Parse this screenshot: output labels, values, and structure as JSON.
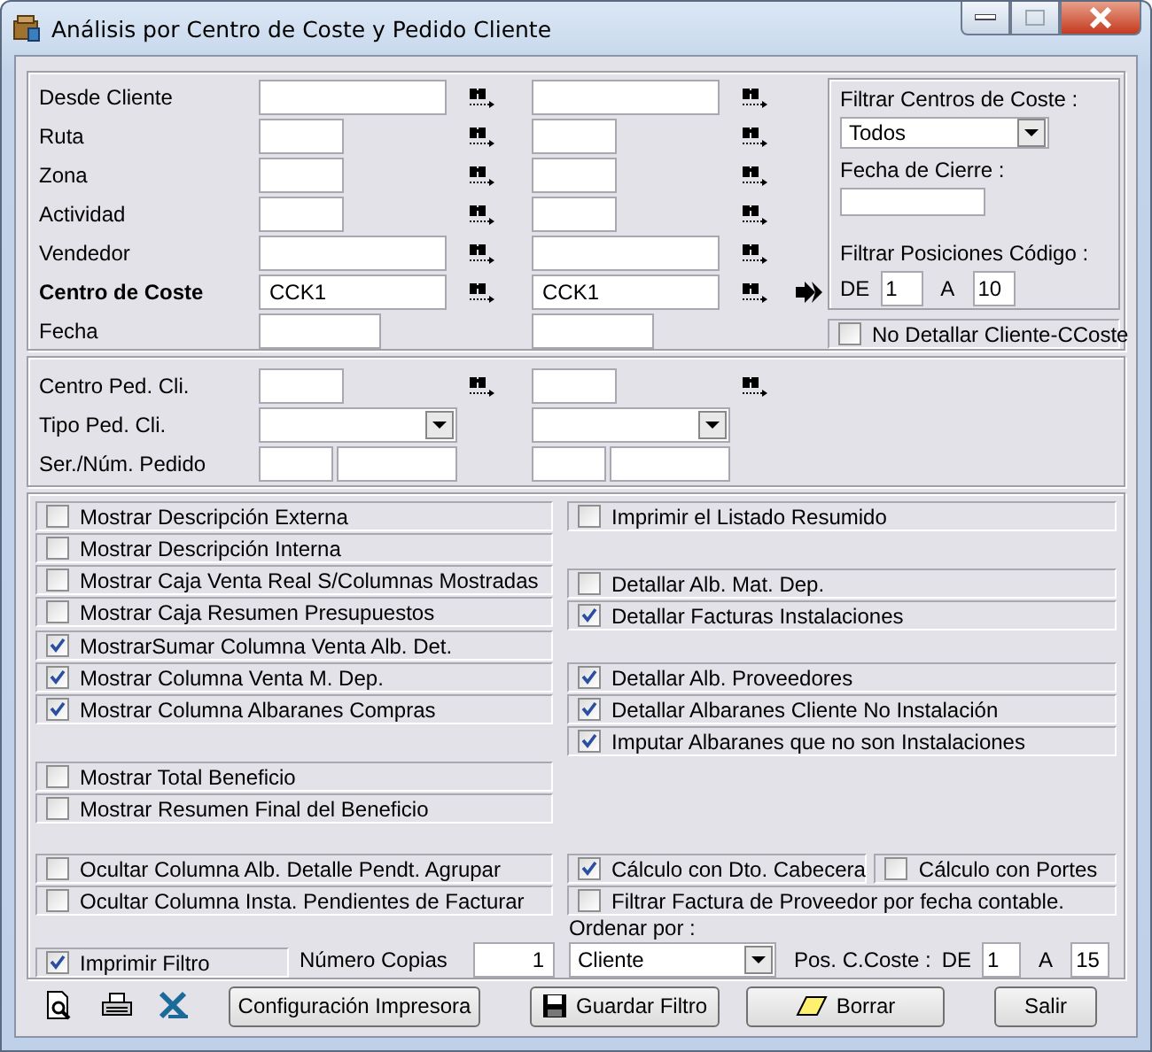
{
  "window": {
    "title": "Análisis por Centro de Coste y Pedido Cliente"
  },
  "filters": [
    {
      "label": "Desde Cliente",
      "kind": "wide",
      "bold": false,
      "search": true,
      "arrow": false
    },
    {
      "label": "Ruta",
      "kind": "short",
      "bold": false,
      "search": true,
      "arrow": false
    },
    {
      "label": "Zona",
      "kind": "short",
      "bold": false,
      "search": true,
      "arrow": false
    },
    {
      "label": "Actividad",
      "kind": "short",
      "bold": false,
      "search": true,
      "arrow": false
    },
    {
      "label": "Vendedor",
      "kind": "wide",
      "bold": false,
      "search": true,
      "arrow": false
    },
    {
      "label": "Centro de Coste",
      "kind": "wide",
      "bold": true,
      "search": true,
      "arrow": true,
      "from": "CCK1",
      "to": "CCK1"
    },
    {
      "label": "Fecha",
      "kind": "medium",
      "bold": false,
      "search": false,
      "arrow": false
    }
  ],
  "side": {
    "centros_label": "Filtrar Centros de Coste :",
    "centros_value": "Todos",
    "cierre_label": "Fecha de Cierre :",
    "pos_label": "Filtrar Posiciones Código :",
    "de_label": "DE",
    "from": "1",
    "a_label": "A",
    "to": "10",
    "no_detallar": {
      "label": "No Detallar Cliente-CCoste",
      "checked": false
    }
  },
  "pedido_filters": [
    {
      "label": "Centro Ped. Cli.",
      "kind": "short",
      "bold": false,
      "search": true,
      "arrow": false
    },
    {
      "label": "Tipo Ped. Cli.",
      "kind": "select",
      "bold": false,
      "search": false,
      "arrow": false
    },
    {
      "label": "Ser./Núm. Pedido",
      "kind": "pair",
      "bold": false,
      "search": false,
      "arrow": false
    }
  ],
  "left_groups": [
    {
      "rows": [
        [
          {
            "label": "Mostrar Descripción Externa",
            "checked": false
          }
        ],
        [
          {
            "label": "Mostrar Descripción Interna",
            "checked": false
          }
        ]
      ]
    },
    {
      "rows": [
        [
          {
            "label": "Mostrar Caja Venta Real S/Columnas Mostradas",
            "checked": false
          }
        ],
        [
          {
            "label": "Mostrar Caja Resumen Presupuestos",
            "checked": false
          }
        ]
      ]
    },
    {
      "rows": [
        [
          {
            "label": "MostrarSumar Columna Venta Alb. Det.",
            "checked": true
          }
        ],
        [
          {
            "label": "Mostrar Columna Venta M. Dep.",
            "checked": true
          }
        ],
        [
          {
            "label": "Mostrar Columna Albaranes Compras",
            "checked": true
          }
        ]
      ]
    },
    {
      "rows": [
        [
          {
            "label": "Mostrar Total Beneficio",
            "checked": false
          }
        ],
        [
          {
            "label": "Mostrar Resumen Final del Beneficio",
            "checked": false
          }
        ]
      ]
    }
  ],
  "right_groups": [
    {
      "rows": [
        [
          {
            "label": "Imprimir el Listado Resumido",
            "checked": false
          }
        ]
      ]
    },
    {
      "rows": [
        [
          {
            "label": "Detallar Alb. Mat. Dep.",
            "checked": false
          }
        ],
        [
          {
            "label": "Detallar Facturas Instalaciones",
            "checked": true
          }
        ]
      ]
    },
    {
      "rows": [
        [
          {
            "label": "Detallar Alb. Proveedores",
            "checked": true
          }
        ],
        [
          {
            "label": "Detallar Albaranes Cliente No Instalación",
            "checked": true
          }
        ],
        [
          {
            "label": "Imputar Albaranes que no son Instalaciones",
            "checked": true
          }
        ]
      ]
    }
  ],
  "bottom_left": {
    "rows": [
      [
        {
          "label": "Ocultar Columna Alb. Detalle Pendt. Agrupar",
          "checked": false
        }
      ],
      [
        {
          "label": "Ocultar Columna Insta. Pendientes de Facturar",
          "checked": false
        }
      ]
    ]
  },
  "bottom_right": {
    "rows": [
      [
        {
          "label": "Cálculo con Dto. Cabecera",
          "checked": true
        },
        {
          "label": "Cálculo con Portes",
          "checked": false
        }
      ],
      [
        {
          "label": "Filtrar Factura de Proveedor por fecha contable.",
          "checked": false
        }
      ]
    ]
  },
  "print_filter": {
    "label": "Imprimir Filtro",
    "checked": true
  },
  "copies": {
    "label": "Número Copias",
    "value": "1"
  },
  "order": {
    "label": "Ordenar por :",
    "value": "Cliente"
  },
  "pos_ccoste": {
    "label": "Pos. C.Coste :",
    "de_label": "DE",
    "from": "1",
    "a_label": "A",
    "to": "15"
  },
  "tools": [
    {
      "kind": "preview"
    },
    {
      "kind": "print"
    },
    {
      "kind": "excel"
    }
  ],
  "buttons": [
    {
      "label": "Configuración Impresora",
      "kind": "plain"
    },
    {
      "label": "Guardar Filtro",
      "kind": "save"
    },
    {
      "label": "Borrar",
      "kind": "eraser"
    },
    {
      "label": "Salir",
      "kind": "plain"
    }
  ]
}
